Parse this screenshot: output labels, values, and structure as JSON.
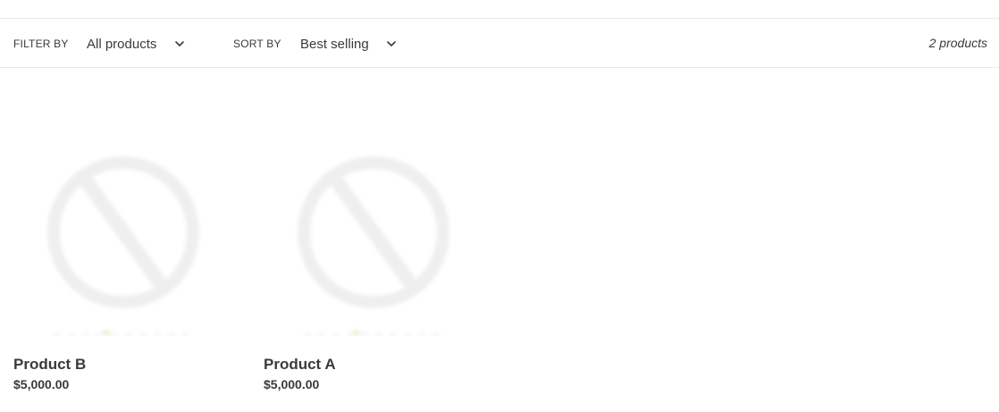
{
  "filter": {
    "label": "FILTER BY",
    "selected": "All products"
  },
  "sort": {
    "label": "SORT BY",
    "selected": "Best selling"
  },
  "product_count": "2 products",
  "products": [
    {
      "title": "Product B",
      "price": "$5,000.00",
      "image_icon": "placeholder-image-icon"
    },
    {
      "title": "Product A",
      "price": "$5,000.00",
      "image_icon": "placeholder-image-icon"
    }
  ],
  "colors": {
    "text": "#3a3a3a",
    "border": "#e8e9eb",
    "placeholder": "#efefef"
  }
}
